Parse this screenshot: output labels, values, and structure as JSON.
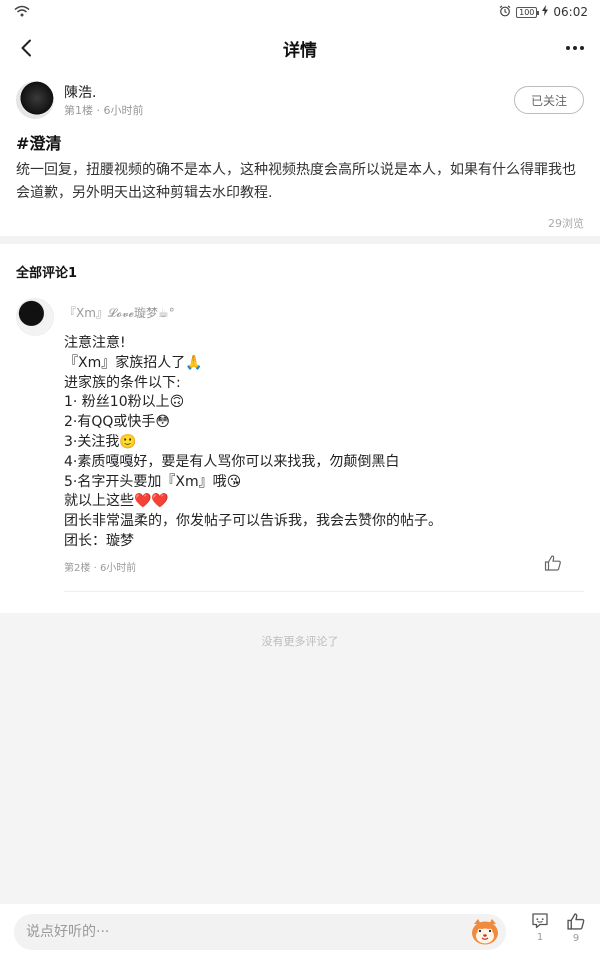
{
  "status_bar": {
    "battery": "100",
    "time": "06:02"
  },
  "nav": {
    "title": "详情"
  },
  "post": {
    "author_name": "陳浩.",
    "floor": "第1楼",
    "separator": "·",
    "time_ago": "6小时前",
    "follow_label": "已关注",
    "tag": "#澄清",
    "body": "统一回复，扭腰视频的确不是本人，这种视频热度会高所以说是本人，如果有什么得罪我也会道歉，另外明天出这种剪辑去水印教程.",
    "views": "29浏览"
  },
  "comments_header": "全部评论1",
  "comment": {
    "author_name": "『Xm』𝓛𝓸𝓿𝓮璇梦☕°",
    "lines": [
      "注意注意!",
      "『Xm』家族招人了🙏",
      "进家族的条件以下:",
      "1· 粉丝10粉以上🙃",
      "2·有QQ或快手😳",
      "3·关注我🙂",
      "4·素质嘎嘎好，要是有人骂你可以来找我，勿颠倒黑白",
      "5·名字开头要加『Xm』哦😘",
      "就以上这些❤️❤️",
      "团长非常温柔的，你发帖子可以告诉我，我会去赞你的帖子。",
      "团长：璇梦"
    ],
    "floor": "第2楼",
    "separator": "·",
    "time_ago": "6小时前"
  },
  "no_more": "没有更多评论了",
  "bottom_bar": {
    "input_placeholder": "说点好听的···",
    "comment_count": "1",
    "like_count": "9"
  },
  "icons": {
    "back": "back-arrow-icon",
    "more": "more-dots-icon",
    "wifi": "wifi-icon",
    "alarm": "alarm-icon",
    "charging": "charging-bolt-icon",
    "like": "thumbs-up-icon",
    "comment": "speech-bubble-icon",
    "mascot": "mascot-face-icon"
  },
  "colors": {
    "mascot_orange": "#f08a3c",
    "divider": "#f3f3f3"
  }
}
